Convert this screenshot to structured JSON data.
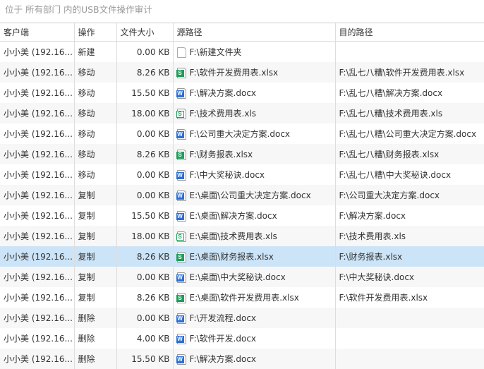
{
  "title": "位于 所有部门 内的USB文件操作审计",
  "columns": [
    "客户端",
    "操作",
    "文件大小",
    "源路径",
    "目的路径"
  ],
  "rows": [
    {
      "client": "小小美 (192.16...",
      "op": "新建",
      "size": "0.00 KB",
      "icon": "folder-file-icon",
      "src": "F:\\新建文件夹",
      "dst": ""
    },
    {
      "client": "小小美 (192.16...",
      "op": "移动",
      "size": "8.26 KB",
      "icon": "xlsx-icon",
      "src": "F:\\软件开发费用表.xlsx",
      "dst": "F:\\乱七八糟\\软件开发费用表.xlsx"
    },
    {
      "client": "小小美 (192.16...",
      "op": "移动",
      "size": "15.50 KB",
      "icon": "docx-icon",
      "src": "F:\\解决方案.docx",
      "dst": "F:\\乱七八糟\\解决方案.docx"
    },
    {
      "client": "小小美 (192.16...",
      "op": "移动",
      "size": "18.00 KB",
      "icon": "xls-icon",
      "src": "F:\\技术费用表.xls",
      "dst": "F:\\乱七八糟\\技术费用表.xls"
    },
    {
      "client": "小小美 (192.16...",
      "op": "移动",
      "size": "0.00 KB",
      "icon": "docx-icon",
      "src": "F:\\公司重大决定方案.docx",
      "dst": "F:\\乱七八糟\\公司重大决定方案.docx"
    },
    {
      "client": "小小美 (192.16...",
      "op": "移动",
      "size": "8.26 KB",
      "icon": "xlsx-icon",
      "src": "F:\\财务报表.xlsx",
      "dst": "F:\\乱七八糟\\财务报表.xlsx"
    },
    {
      "client": "小小美 (192.16...",
      "op": "移动",
      "size": "0.00 KB",
      "icon": "docx-icon",
      "src": "F:\\中大奖秘诀.docx",
      "dst": "F:\\乱七八糟\\中大奖秘诀.docx"
    },
    {
      "client": "小小美 (192.16...",
      "op": "复制",
      "size": "0.00 KB",
      "icon": "docx-icon",
      "src": "E:\\桌面\\公司重大决定方案.docx",
      "dst": "F:\\公司重大决定方案.docx"
    },
    {
      "client": "小小美 (192.16...",
      "op": "复制",
      "size": "15.50 KB",
      "icon": "docx-icon",
      "src": "E:\\桌面\\解决方案.docx",
      "dst": "F:\\解决方案.docx"
    },
    {
      "client": "小小美 (192.16...",
      "op": "复制",
      "size": "18.00 KB",
      "icon": "xls-icon",
      "src": "E:\\桌面\\技术费用表.xls",
      "dst": "F:\\技术费用表.xls"
    },
    {
      "client": "小小美 (192.16...",
      "op": "复制",
      "size": "8.26 KB",
      "icon": "xlsx-icon",
      "src": "E:\\桌面\\财务报表.xlsx",
      "dst": "F:\\财务报表.xlsx"
    },
    {
      "client": "小小美 (192.16...",
      "op": "复制",
      "size": "0.00 KB",
      "icon": "docx-icon",
      "src": "E:\\桌面\\中大奖秘诀.docx",
      "dst": "F:\\中大奖秘诀.docx"
    },
    {
      "client": "小小美 (192.16...",
      "op": "复制",
      "size": "8.26 KB",
      "icon": "xlsx-icon",
      "src": "E:\\桌面\\软件开发费用表.xlsx",
      "dst": "F:\\软件开发费用表.xlsx"
    },
    {
      "client": "小小美 (192.16...",
      "op": "删除",
      "size": "0.00 KB",
      "icon": "docx-icon",
      "src": "F:\\开发流程.docx",
      "dst": ""
    },
    {
      "client": "小小美 (192.16...",
      "op": "删除",
      "size": "4.00 KB",
      "icon": "docx-icon",
      "src": "F:\\软件开发.docx",
      "dst": ""
    },
    {
      "client": "小小美 (192.16...",
      "op": "删除",
      "size": "15.50 KB",
      "icon": "docx-icon",
      "src": "F:\\解决方案.docx",
      "dst": ""
    }
  ],
  "selected_row": 10
}
